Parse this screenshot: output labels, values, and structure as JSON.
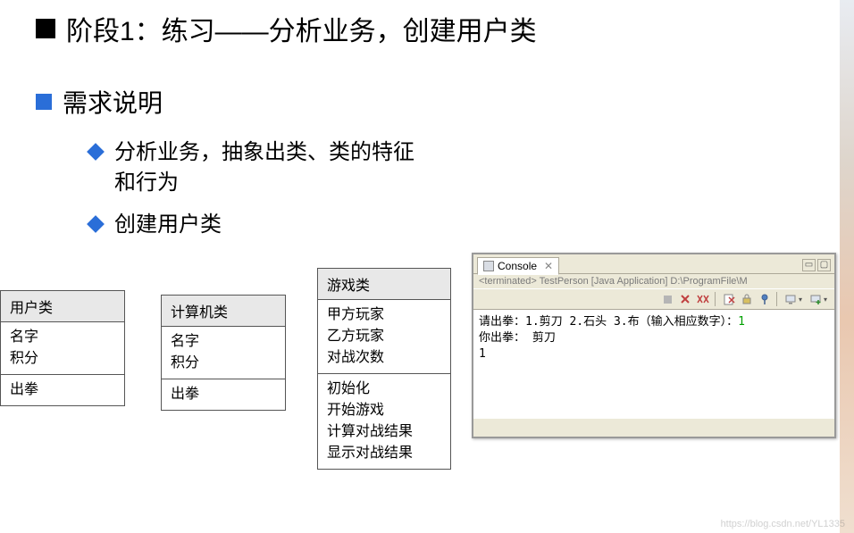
{
  "title": "阶段1：练习——分析业务，创建用户类",
  "subtitle": "需求说明",
  "bullets": [
    "分析业务，抽象出类、类的特征和行为",
    "创建用户类"
  ],
  "classes": {
    "user": {
      "name": "用户类",
      "attrs": [
        "名字",
        "积分"
      ],
      "methods": [
        "出拳"
      ]
    },
    "computer": {
      "name": "计算机类",
      "attrs": [
        "名字",
        "积分"
      ],
      "methods": [
        "出拳"
      ]
    },
    "game": {
      "name": "游戏类",
      "attrs": [
        "甲方玩家",
        "乙方玩家",
        "对战次数"
      ],
      "methods": [
        "初始化",
        "开始游戏",
        "计算对战结果",
        "显示对战结果"
      ]
    }
  },
  "console": {
    "tab_label": "Console",
    "status": "<terminated> TestPerson [Java Application] D:\\ProgramFile\\M",
    "lines": {
      "l1a": "请出拳：1.剪刀 2.石头 3.布（输入相应数字）：",
      "l1b": "1",
      "l2": "你出拳： 剪刀",
      "l3": "1"
    }
  },
  "chart_data": {
    "type": "table",
    "note": "UML-style class diagrams for three classes",
    "classes": [
      {
        "name": "用户类",
        "attributes": [
          "名字",
          "积分"
        ],
        "methods": [
          "出拳"
        ]
      },
      {
        "name": "计算机类",
        "attributes": [
          "名字",
          "积分"
        ],
        "methods": [
          "出拳"
        ]
      },
      {
        "name": "游戏类",
        "attributes": [
          "甲方玩家",
          "乙方玩家",
          "对战次数"
        ],
        "methods": [
          "初始化",
          "开始游戏",
          "计算对战结果",
          "显示对战结果"
        ]
      }
    ]
  },
  "watermark": "https://blog.csdn.net/YL1335"
}
